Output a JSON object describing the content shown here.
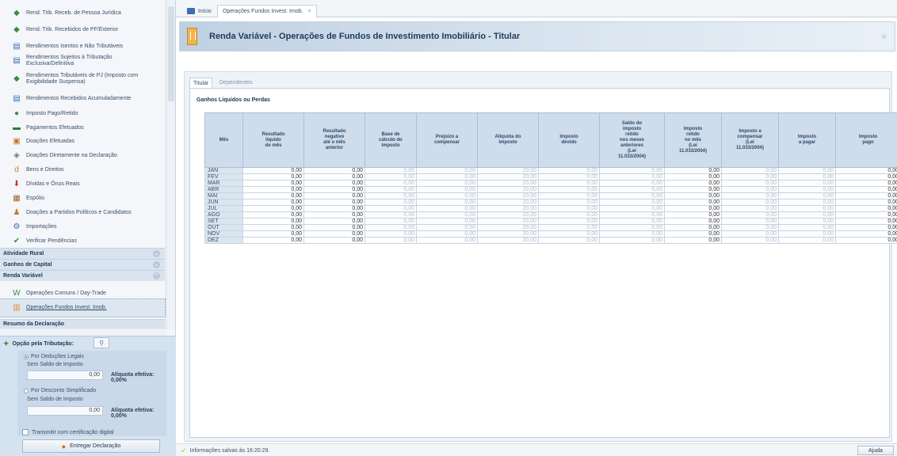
{
  "sidebar": {
    "items": [
      {
        "label": "Rend. Trib. Receb. de Pessoa Jurídica",
        "icon": "money-hand-icon"
      },
      {
        "label": "Rend. Trib. Recebidos de PF/Exterior",
        "icon": "money-hand-icon"
      },
      {
        "label": "Rendimentos Isentos e Não Tributáveis",
        "icon": "document-icon"
      },
      {
        "label": "Rendimentos Sujeitos à Tributação Exclusiva/Definitiva",
        "icon": "document-icon"
      },
      {
        "label": "Rendimentos Tributáveis de PJ (Imposto com Exigibilidade Suspensa)",
        "icon": "money-hand-icon"
      },
      {
        "label": "Rendimentos Recebidos Acumuladamente",
        "icon": "document-icon"
      },
      {
        "label": "Imposto Pago/Retido",
        "icon": "person-icon"
      },
      {
        "label": "Pagamentos Efetuados",
        "icon": "money-icon"
      },
      {
        "label": "Doações Efetuadas",
        "icon": "gift-icon"
      },
      {
        "label": "Doações Diretamente na Declaração",
        "icon": "box-icon"
      },
      {
        "label": "Bens e Direitos",
        "icon": "letter-d-icon"
      },
      {
        "label": "Dívidas e Ônus Reais",
        "icon": "arrow-down-icon"
      },
      {
        "label": "Espólio",
        "icon": "wallet-icon"
      },
      {
        "label": "Doações a Partidos Políticos e Candidatos",
        "icon": "flask-icon"
      },
      {
        "label": "Importações",
        "icon": "gear-icon"
      },
      {
        "label": "Verificar Pendências",
        "icon": "check-icon"
      }
    ],
    "sections": [
      {
        "label": "Atividade Rural",
        "caret": "⌄"
      },
      {
        "label": "Ganhos de Capital",
        "caret": "⌄"
      },
      {
        "label": "Renda Variável",
        "caret": "⌃"
      }
    ],
    "renda_items": [
      {
        "label": "Operações Comuns / Day-Trade",
        "icon": "chart-w-icon"
      },
      {
        "label": "Operações Fundos Invest. Imob.",
        "icon": "building-icon"
      }
    ],
    "cut_section": "Resumo da Declaração"
  },
  "tributacao": {
    "title": "Opção pela Tributação:",
    "search_icon": "search-icon",
    "deducoes_label": "Por Deduções Legais",
    "deducoes_sub": "Sem Saldo de Imposto",
    "deducoes_value": "0,00",
    "deducoes_aliquota": "Alíquota efetiva: 0,00%",
    "simplificado_label": "Por Desconto Simplificado",
    "simplificado_sub": "Sem Saldo de Imposto",
    "simplificado_value": "0,00",
    "simplificado_aliquota": "Alíquota efetiva: 0,00%",
    "cert_label": "Transmitir com certificação digital",
    "entregar_label": "Entregar Declaração"
  },
  "tabs": {
    "inicio": "Início",
    "fii": "Operações Fundos Invest. Imob.",
    "close": "×"
  },
  "header": {
    "title": "Renda Variável - Operações de Fundos de Investimento Imobiliário - Titular"
  },
  "subtabs": {
    "titular": "Titular",
    "dependentes": "Dependentes"
  },
  "section_title": "Ganhos Líquidos ou Perdas",
  "table": {
    "columns": [
      "Mês",
      "Resultado\nlíquido\ndo mês",
      "Resultado\nnegativo\naté o mês\nanterior",
      "Base de\ncálculo do\nimposto",
      "Prejuízo a\ncompensar",
      "Alíquota do\nimposto",
      "Imposto\ndevido",
      "Saldo do\nimposto\nretido\nnos meses\nanteriores\n(Lei\n11.033/2004)",
      "Imposto\nretido\nno mês\n(Lei\n11.033/2004)",
      "Imposto a\ncompensar\n(Lei\n11.033/2004)",
      "Imposto\na pagar",
      "Imposto\npago"
    ],
    "rows": [
      {
        "mes": "JAN",
        "values": [
          "0,00",
          "0,00",
          "0,00",
          "0,00",
          "20,00",
          "0,00",
          "0,00",
          "0,00",
          "0,00",
          "0,00",
          "0,00"
        ]
      },
      {
        "mes": "FEV",
        "values": [
          "0,00",
          "0,00",
          "0,00",
          "0,00",
          "20,00",
          "0,00",
          "0,00",
          "0,00",
          "0,00",
          "0,00",
          "0,00"
        ]
      },
      {
        "mes": "MAR",
        "values": [
          "0,00",
          "0,00",
          "0,00",
          "0,00",
          "20,00",
          "0,00",
          "0,00",
          "0,00",
          "0,00",
          "0,00",
          "0,00"
        ]
      },
      {
        "mes": "ABR",
        "values": [
          "0,00",
          "0,00",
          "0,00",
          "0,00",
          "20,00",
          "0,00",
          "0,00",
          "0,00",
          "0,00",
          "0,00",
          "0,00"
        ]
      },
      {
        "mes": "MAI",
        "values": [
          "0,00",
          "0,00",
          "0,00",
          "0,00",
          "20,00",
          "0,00",
          "0,00",
          "0,00",
          "0,00",
          "0,00",
          "0,00"
        ]
      },
      {
        "mes": "JUN",
        "values": [
          "0,00",
          "0,00",
          "0,00",
          "0,00",
          "20,00",
          "0,00",
          "0,00",
          "0,00",
          "0,00",
          "0,00",
          "0,00"
        ]
      },
      {
        "mes": "JUL",
        "values": [
          "0,00",
          "0,00",
          "0,00",
          "0,00",
          "20,00",
          "0,00",
          "0,00",
          "0,00",
          "0,00",
          "0,00",
          "0,00"
        ]
      },
      {
        "mes": "AGO",
        "values": [
          "0,00",
          "0,00",
          "0,00",
          "0,00",
          "20,00",
          "0,00",
          "0,00",
          "0,00",
          "0,00",
          "0,00",
          "0,00"
        ]
      },
      {
        "mes": "SET",
        "values": [
          "0,00",
          "0,00",
          "0,00",
          "0,00",
          "20,00",
          "0,00",
          "0,00",
          "0,00",
          "0,00",
          "0,00",
          "0,00"
        ]
      },
      {
        "mes": "OUT",
        "values": [
          "0,00",
          "0,00",
          "0,00",
          "0,00",
          "20,00",
          "0,00",
          "0,00",
          "0,00",
          "0,00",
          "0,00",
          "0,00"
        ]
      },
      {
        "mes": "NOV",
        "values": [
          "0,00",
          "0,00",
          "0,00",
          "0,00",
          "20,00",
          "0,00",
          "0,00",
          "0,00",
          "0,00",
          "0,00",
          "0,00"
        ]
      },
      {
        "mes": "DEZ",
        "values": [
          "0,00",
          "0,00",
          "0,00",
          "0,00",
          "20,00",
          "0,00",
          "0,00",
          "0,00",
          "0,00",
          "0,00",
          "0,00"
        ]
      }
    ],
    "editable_columns": [
      0,
      1,
      7,
      10
    ]
  },
  "status": {
    "message": "Informações salvas às 16:20:29.",
    "ajuda": "Ajuda"
  },
  "colors": {
    "accent": "#1f3a57",
    "section_bg": "#d8e3ef",
    "table_header": "#cfdceb"
  }
}
